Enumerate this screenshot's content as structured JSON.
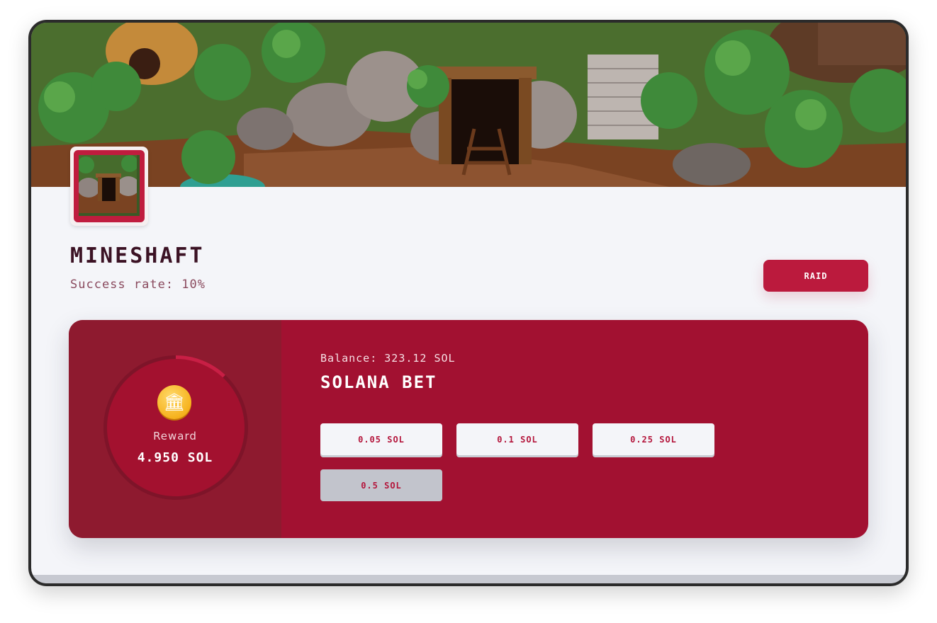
{
  "location": {
    "name": "MINESHAFT",
    "success_rate": "Success rate: 10%"
  },
  "actions": {
    "raid_label": "RAID"
  },
  "reward": {
    "label": "Reward",
    "value": "4.950 SOL",
    "progress_fraction": 0.12,
    "icon": "bank-icon"
  },
  "bet": {
    "balance": "Balance: 323.12 SOL",
    "title": "SOLANA BET",
    "options": [
      "0.05 SOL",
      "0.1 SOL",
      "0.25 SOL",
      "0.5 SOL"
    ],
    "selected": "0.5 SOL"
  },
  "colors": {
    "accent": "#bb1a3d",
    "card": "#a21131",
    "card_left": "#8e1a2f",
    "title": "#3b1224"
  }
}
